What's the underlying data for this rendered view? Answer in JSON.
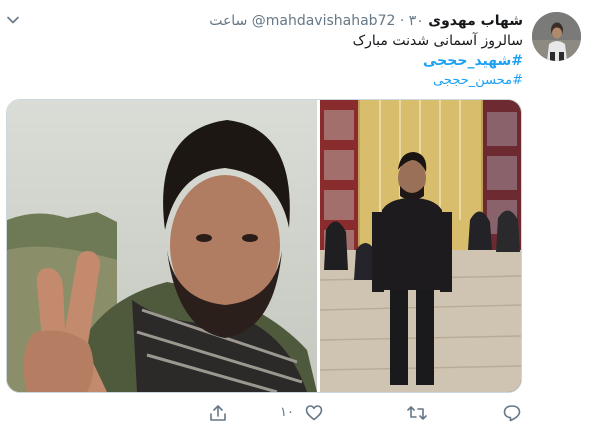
{
  "tweet": {
    "author_name": "شهاب مهدوی",
    "handle": "@mahdavishahab72",
    "time": "۳۰ ساعت",
    "separator": "·",
    "text": "سالروز آسمانی شدنت مبارک",
    "hashtags": [
      "#شهید_حججی",
      "#محسن_حججی"
    ],
    "like_count": "۱۰"
  },
  "icons": {
    "more": "chevron-down-icon",
    "reply": "reply-icon",
    "retweet": "retweet-icon",
    "like": "heart-icon",
    "share": "share-icon"
  },
  "colors": {
    "link": "#1da1f2",
    "secondary_text": "#657786",
    "border": "#ccd6dd"
  }
}
